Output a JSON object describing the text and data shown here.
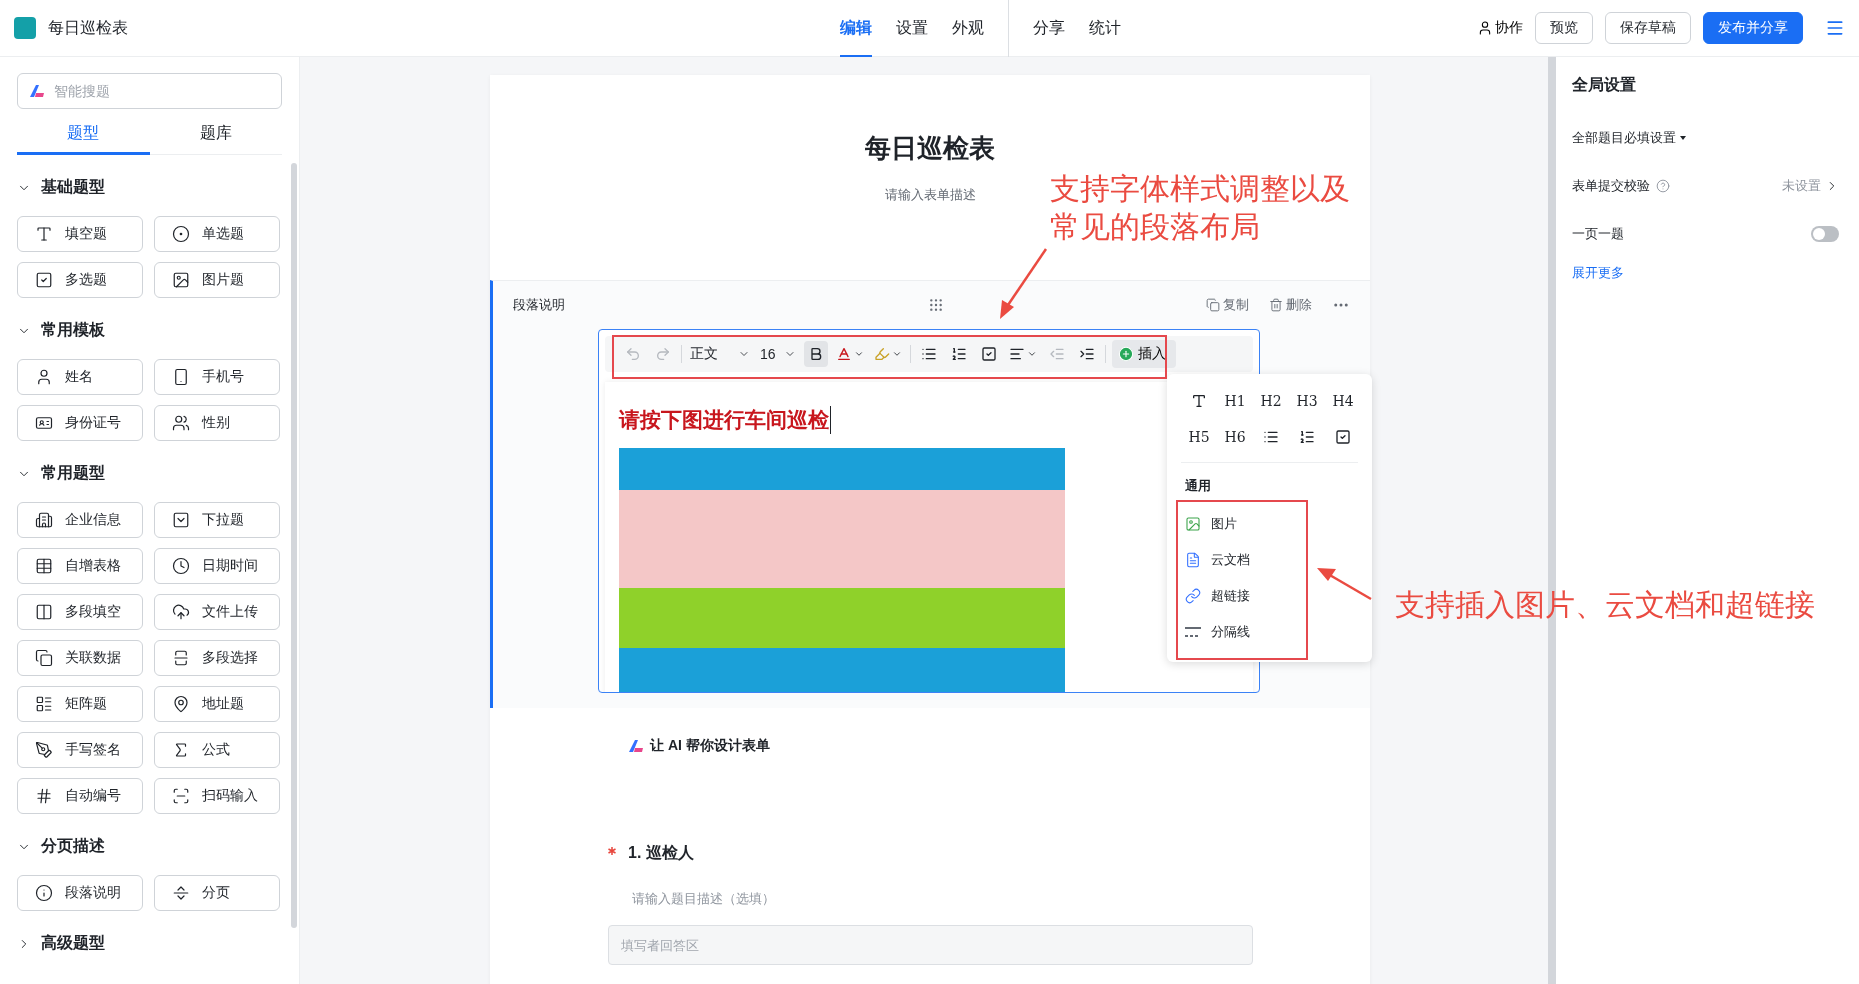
{
  "app": {
    "title": "每日巡检表"
  },
  "nav_groups": [
    {
      "tabs": [
        {
          "label": "编辑",
          "selected": true
        },
        {
          "label": "设置",
          "selected": false
        },
        {
          "label": "外观",
          "selected": false
        }
      ]
    },
    {
      "tabs": [
        {
          "label": "分享",
          "selected": false
        },
        {
          "label": "统计",
          "selected": false
        }
      ]
    }
  ],
  "header_actions": {
    "collaborate": "协作",
    "buttons": [
      {
        "label": "预览",
        "kind": "default"
      },
      {
        "label": "保存草稿",
        "kind": "default"
      },
      {
        "label": "发布并分享",
        "kind": "primary"
      }
    ]
  },
  "sidebar": {
    "search_placeholder": "智能搜题",
    "tabs": [
      {
        "label": "题型",
        "selected": true
      },
      {
        "label": "题库",
        "selected": false
      }
    ],
    "sections": [
      {
        "title": "基础题型",
        "expanded": true,
        "items": [
          "填空题",
          "单选题",
          "多选题",
          "图片题"
        ]
      },
      {
        "title": "常用模板",
        "expanded": true,
        "items": [
          "姓名",
          "手机号",
          "身份证号",
          "性别"
        ]
      },
      {
        "title": "常用题型",
        "expanded": true,
        "items": [
          "企业信息",
          "下拉题",
          "自增表格",
          "日期时间",
          "多段填空",
          "文件上传",
          "关联数据",
          "多段选择",
          "矩阵题",
          "地址题",
          "手写签名",
          "公式",
          "自动编号",
          "扫码输入"
        ]
      },
      {
        "title": "分页描述",
        "expanded": true,
        "items": [
          "段落说明",
          "分页"
        ]
      },
      {
        "title": "高级题型",
        "expanded": false
      }
    ]
  },
  "form": {
    "title": "每日巡检表",
    "description": "请输入表单描述",
    "block": {
      "label": "段落说明",
      "selected": true,
      "actions": [
        "复制",
        "删除"
      ],
      "toolbar": {
        "style": "正文",
        "size": "16",
        "bold_active": true,
        "insert": "插入"
      },
      "heading": "请按下图进行车间巡检"
    },
    "ai_link": "让 AI 帮你设计表单",
    "question": {
      "required": true,
      "title": "1. 巡检人",
      "description": "请输入题目描述（选填）",
      "placeholder": "填写者回答区"
    }
  },
  "insert_menu": {
    "headings": [
      "H1",
      "H2",
      "H3",
      "H4",
      "H5",
      "H6"
    ],
    "section_title": "通用",
    "items": [
      "图片",
      "云文档",
      "超链接",
      "分隔线"
    ]
  },
  "settings": {
    "title": "全局设置",
    "rows": [
      {
        "kind": "dropdown",
        "label": "全部题目必填设置"
      },
      {
        "kind": "link",
        "label": "表单提交校验",
        "value": "未设置"
      },
      {
        "kind": "toggle",
        "label": "一页一题",
        "on": false
      }
    ],
    "expand_link": "展开更多"
  },
  "annotations": [
    {
      "lines": [
        "支持字体样式调整以及",
        "常见的段落布局"
      ]
    },
    {
      "lines": [
        "支持插入图片、云文档和超链接"
      ]
    }
  ]
}
